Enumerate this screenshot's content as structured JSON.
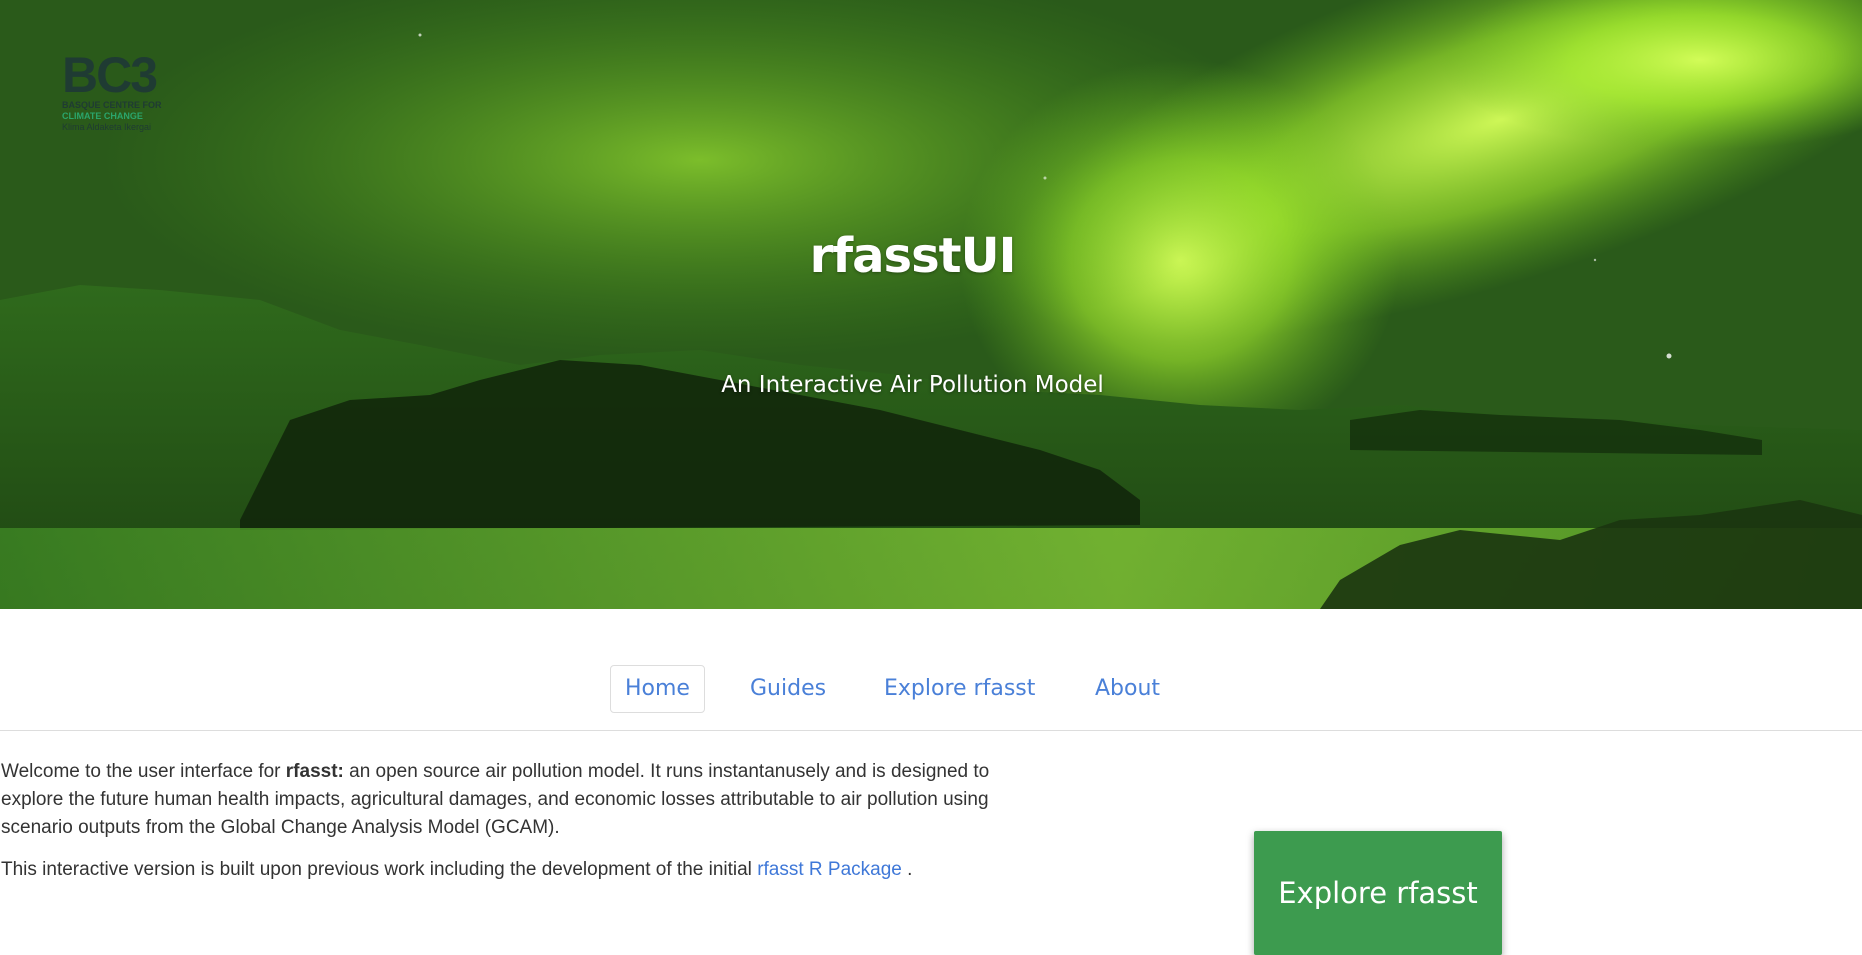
{
  "logo": {
    "mark": "BC3",
    "line1": "BASQUE CENTRE FOR",
    "line2": "CLIMATE CHANGE",
    "line3": "Klima Aldaketa Ikergai"
  },
  "hero": {
    "title": "rfasstUI",
    "subtitle": "An Interactive Air Pollution Model"
  },
  "nav": {
    "tabs": [
      {
        "label": "Home",
        "active": true
      },
      {
        "label": "Guides",
        "active": false
      },
      {
        "label": "Explore rfasst",
        "active": false
      },
      {
        "label": "About",
        "active": false
      }
    ]
  },
  "content": {
    "p1_before": "Welcome to the user interface for ",
    "p1_bold": "rfasst:",
    "p1_after": " an open source air pollution model. It runs instantanusely and is designed to explore the future human health impacts, agricultural damages, and economic losses attributable to air pollution using scenario outputs from the Global Change Analysis Model (GCAM).",
    "p2_before": "This interactive version is built upon previous work including the development of the initial ",
    "p2_link": "rfasst R Package",
    "p2_after": " ."
  },
  "cta": {
    "label": "Explore rfasst"
  },
  "colors": {
    "link": "#4a80d8",
    "cta_bg": "#3d9b4f",
    "aurora": "#b8ff3a"
  }
}
